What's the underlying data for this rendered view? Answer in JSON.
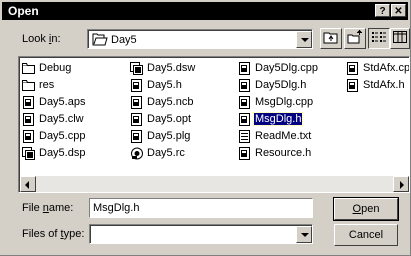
{
  "window": {
    "title": "Open",
    "help_button": "?",
    "close_button": "✕"
  },
  "look_in": {
    "label_prefix": "Look ",
    "label_hot": "i",
    "label_suffix": "n:",
    "value": "Day5"
  },
  "files": [
    {
      "name": "Debug",
      "icon": "folder-icon"
    },
    {
      "name": "res",
      "icon": "folder-icon"
    },
    {
      "name": "Day5.aps",
      "icon": "cpp-file-icon"
    },
    {
      "name": "Day5.clw",
      "icon": "cpp-file-icon"
    },
    {
      "name": "Day5.cpp",
      "icon": "cpp-file-icon"
    },
    {
      "name": "Day5.dsp",
      "icon": "project-file-icon"
    },
    {
      "name": "Day5.dsw",
      "icon": "project-file-icon"
    },
    {
      "name": "Day5.h",
      "icon": "cpp-file-icon"
    },
    {
      "name": "Day5.ncb",
      "icon": "cpp-file-icon"
    },
    {
      "name": "Day5.opt",
      "icon": "cpp-file-icon"
    },
    {
      "name": "Day5.plg",
      "icon": "cpp-file-icon"
    },
    {
      "name": "Day5.rc",
      "icon": "resource-file-icon"
    },
    {
      "name": "Day5Dlg.cpp",
      "icon": "cpp-file-icon"
    },
    {
      "name": "Day5Dlg.h",
      "icon": "cpp-file-icon"
    },
    {
      "name": "MsgDlg.cpp",
      "icon": "cpp-file-icon"
    },
    {
      "name": "MsgDlg.h",
      "icon": "cpp-file-icon",
      "selected": true
    },
    {
      "name": "ReadMe.txt",
      "icon": "text-file-icon"
    },
    {
      "name": "Resource.h",
      "icon": "cpp-file-icon"
    },
    {
      "name": "StdAfx.cpp",
      "icon": "cpp-file-icon"
    },
    {
      "name": "StdAfx.h",
      "icon": "cpp-file-icon"
    }
  ],
  "file_name": {
    "label_prefix": "File ",
    "label_hot": "n",
    "label_suffix": "ame:",
    "value": "MsgDlg.h"
  },
  "file_type": {
    "label_prefix": "Files of ",
    "label_hot": "t",
    "label_suffix": "ype:",
    "value": ""
  },
  "buttons": {
    "open_hot": "O",
    "open_rest": "pen",
    "cancel": "Cancel"
  }
}
